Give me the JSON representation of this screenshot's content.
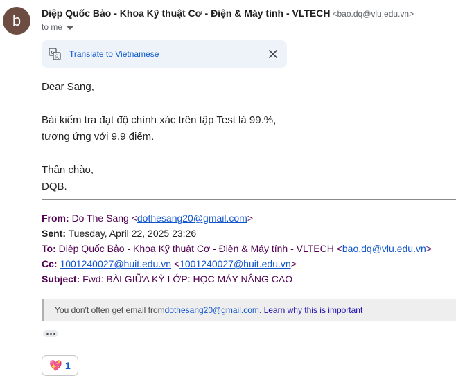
{
  "sender": {
    "avatar_letter": "b",
    "name": "Diệp Quốc Bảo - Khoa Kỹ thuật Cơ - Điện & Máy tính - VLTECH",
    "email": "<bao.dq@vlu.edu.vn>",
    "to_label": "to me"
  },
  "translate": {
    "label": "Translate to Vietnamese",
    "icon": "translate-icon",
    "close_icon": "close-icon"
  },
  "body": {
    "greeting": "Dear Sang,",
    "line1": "Bài kiểm tra đạt độ chính xác trên tập Test là 99.%,",
    "line2": "tương ứng với 9.9 điểm.",
    "closing": "Thân chào,",
    "signature": "DQB."
  },
  "forwarded": {
    "from_label": "From:",
    "from_name": "Do The Sang <",
    "from_email": "dothesang20@gmail.com",
    "from_end": ">",
    "sent_label": "Sent:",
    "sent_value": "Tuesday, April 22, 2025 23:26",
    "to_label": "To:",
    "to_name": "Diệp Quốc Bảo - Khoa Kỹ thuật Cơ - Điện & Máy tính - VLTECH <",
    "to_email": "bao.dq@vlu.edu.vn",
    "to_end": ">",
    "cc_label": "Cc:",
    "cc_email1": "1001240027@huit.edu.vn",
    "cc_mid": " <",
    "cc_email2": "1001240027@huit.edu.vn",
    "cc_end": ">",
    "subject_label": "Subject:",
    "subject_value": "Fwd: BÀI GIỮA KỲ LỚP: HỌC MÁY NÂNG CAO"
  },
  "notice": {
    "prefix": "You don't often get email from ",
    "email": "dothesang20@gmail.com",
    "dot": ".",
    "link": "Learn why this is important"
  },
  "reaction": {
    "emoji": "💖",
    "count": "1"
  },
  "colors": {
    "avatar_bg": "#6d4c41",
    "link": "#1155cc",
    "forward_header": "#500050",
    "translate_bg": "#eef3fa"
  }
}
